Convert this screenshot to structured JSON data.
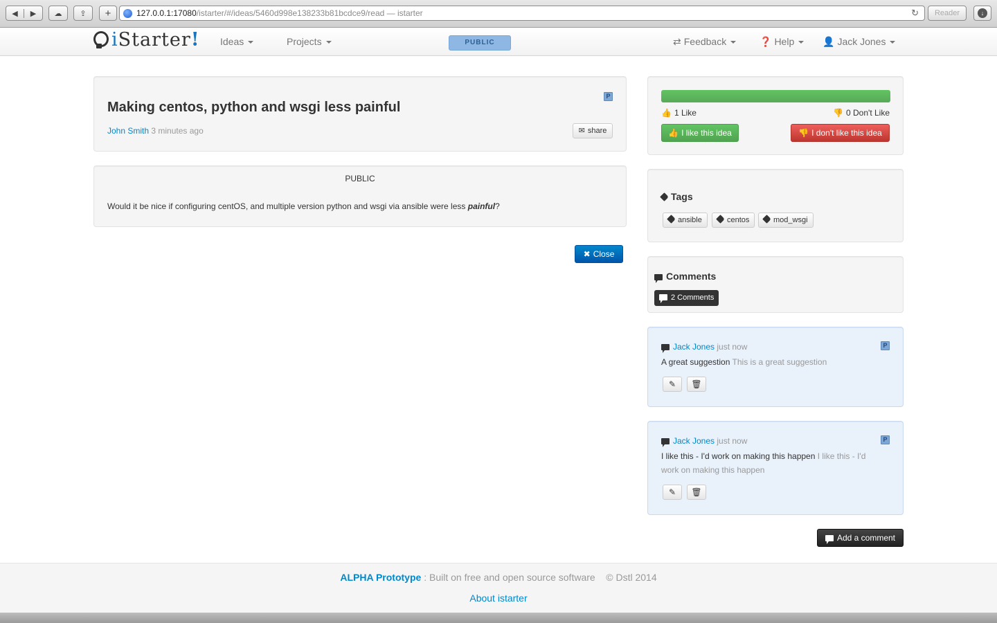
{
  "browser": {
    "url_host": "127.0.0.1:17080",
    "url_path": "/istarter/#/ideas/5460d998e138233b81bcdce9/read — istarter",
    "reader_label": "Reader"
  },
  "navbar": {
    "brand_i": "i",
    "brand_rest": "Starter",
    "brand_ex": "!",
    "ideas": "Ideas",
    "projects": "Projects",
    "public_pill": "PUBLIC",
    "feedback": "Feedback",
    "help": "Help",
    "user": "Jack Jones"
  },
  "idea": {
    "badge": "P",
    "title": "Making centos, python and wsgi less painful",
    "author": "John Smith",
    "time": "3 minutes ago",
    "share": "share",
    "visibility": "PUBLIC",
    "body_before": "Would it be nice if configuring centOS, and multiple version python and wsgi via ansible were less ",
    "body_em": "painful",
    "body_after": "?"
  },
  "close_label": "Close",
  "votes": {
    "like_fraction": 1.0,
    "likes_label": "1 Like",
    "dislikes_label": "0 Don't Like",
    "like_btn": "I like this idea",
    "dislike_btn": "I don't like this idea"
  },
  "tags": {
    "title": "Tags",
    "items": [
      "ansible",
      "centos",
      "mod_wsgi"
    ]
  },
  "comments": {
    "title": "Comments",
    "count_label": "2 Comments",
    "items": [
      {
        "author": "Jack Jones",
        "time": "just now",
        "badge": "P",
        "title": "A great suggestion",
        "body": "This is a great suggestion"
      },
      {
        "author": "Jack Jones",
        "time": "just now",
        "badge": "P",
        "title": "I like this - I'd work on making this happen",
        "body": "I like this - I'd work on making this happen"
      }
    ]
  },
  "add_comment": "Add a comment",
  "footer": {
    "alpha": "ALPHA Prototype",
    "built": " : Built on free and open source software",
    "copyright": "© Dstl 2014",
    "about": "About istarter"
  },
  "colors": {
    "brand_blue": "#1c75bc",
    "link": "#0088cc",
    "success": "#5bb75b",
    "danger": "#da4f49",
    "public_pill": "#8eb7e3"
  },
  "icons": [
    "back-icon",
    "forward-icon",
    "cloud-icon",
    "share-icon",
    "globe-icon",
    "reload-icon",
    "download-icon",
    "bulb-icon",
    "retweet-icon",
    "question-icon",
    "user-icon",
    "envelope-icon",
    "thumbs-up-icon",
    "thumbs-down-icon",
    "tag-icon",
    "comment-icon",
    "pencil-icon",
    "trash-icon",
    "close-icon"
  ]
}
